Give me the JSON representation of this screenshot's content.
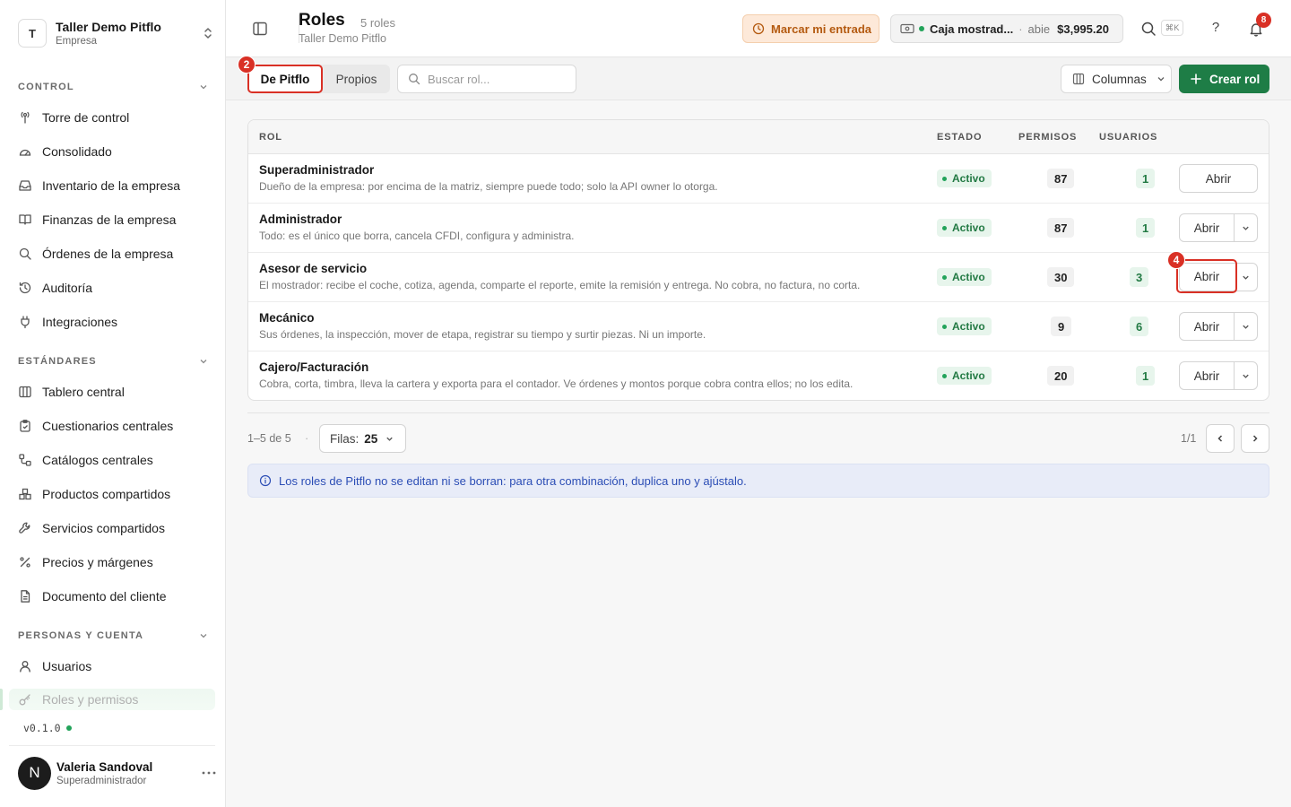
{
  "sidebar": {
    "company": {
      "initial": "T",
      "name": "Taller Demo Pitflo",
      "type": "Empresa"
    },
    "sections": [
      {
        "title": "CONTROL",
        "items": [
          {
            "label": "Torre de control",
            "icon": "antenna-icon"
          },
          {
            "label": "Consolidado",
            "icon": "gauge-icon"
          },
          {
            "label": "Inventario de la empresa",
            "icon": "inbox-icon"
          },
          {
            "label": "Finanzas de la empresa",
            "icon": "book-icon"
          },
          {
            "label": "Órdenes de la empresa",
            "icon": "search-icon"
          },
          {
            "label": "Auditoría",
            "icon": "history-icon"
          },
          {
            "label": "Integraciones",
            "icon": "plug-icon"
          }
        ]
      },
      {
        "title": "ESTÁNDARES",
        "items": [
          {
            "label": "Tablero central",
            "icon": "columns-icon"
          },
          {
            "label": "Cuestionarios centrales",
            "icon": "clipboard-icon"
          },
          {
            "label": "Catálogos centrales",
            "icon": "workflow-icon"
          },
          {
            "label": "Productos compartidos",
            "icon": "boxes-icon"
          },
          {
            "label": "Servicios compartidos",
            "icon": "wrench-icon"
          },
          {
            "label": "Precios y márgenes",
            "icon": "percent-icon"
          },
          {
            "label": "Documento del cliente",
            "icon": "file-icon"
          }
        ]
      },
      {
        "title": "PERSONAS Y CUENTA",
        "items": [
          {
            "label": "Usuarios",
            "icon": "user-icon"
          },
          {
            "label": "Roles y permisos",
            "icon": "key-icon"
          }
        ]
      }
    ],
    "version": "v0.1.0",
    "user": {
      "initial": "N",
      "name": "Valeria Sandoval",
      "role": "Superadministrador"
    }
  },
  "header": {
    "title": "Roles",
    "count": "5 roles",
    "subtitle": "Taller Demo Pitflo",
    "entry_button": "Marcar mi entrada",
    "register": {
      "name": "Caja mostrad...",
      "sep": "·",
      "state": "abie",
      "amount": "$3,995.20"
    },
    "shortcut": "⌘K",
    "help": "?",
    "notifications": "8"
  },
  "filters": {
    "tabs": [
      "De Pitflo",
      "Propios"
    ],
    "search_placeholder": "Buscar rol...",
    "columns_label": "Columnas",
    "create_label": "Crear rol"
  },
  "table": {
    "headers": {
      "rol": "ROL",
      "estado": "ESTADO",
      "permisos": "PERMISOS",
      "usuarios": "USUARIOS"
    },
    "open_label": "Abrir",
    "rows": [
      {
        "name": "Superadministrador",
        "desc": "Dueño de la empresa: por encima de la matriz, siempre puede todo; solo la API owner lo otorga.",
        "status": "Activo",
        "permisos": "87",
        "usuarios": "1"
      },
      {
        "name": "Administrador",
        "desc": "Todo: es el único que borra, cancela CFDI, configura y administra.",
        "status": "Activo",
        "permisos": "87",
        "usuarios": "1"
      },
      {
        "name": "Asesor de servicio",
        "desc": "El mostrador: recibe el coche, cotiza, agenda, comparte el reporte, emite la remisión y entrega. No cobra, no factura, no corta.",
        "status": "Activo",
        "permisos": "30",
        "usuarios": "3"
      },
      {
        "name": "Mecánico",
        "desc": "Sus órdenes, la inspección, mover de etapa, registrar su tiempo y surtir piezas. Ni un importe.",
        "status": "Activo",
        "permisos": "9",
        "usuarios": "6"
      },
      {
        "name": "Cajero/Facturación",
        "desc": "Cobra, corta, timbra, lleva la cartera y exporta para el contador. Ve órdenes y montos porque cobra contra ellos; no los edita.",
        "status": "Activo",
        "permisos": "20",
        "usuarios": "1"
      }
    ]
  },
  "pagination": {
    "range": "1–5 de 5",
    "sep": "·",
    "rows_label": "Filas:",
    "rows_value": "25",
    "page": "1/1"
  },
  "notice": "Los roles de Pitflo no se editan ni se borran: para otra combinación, duplica uno y ajústalo.",
  "markers": {
    "tab": "2",
    "row": "4"
  },
  "colors": {
    "accent": "#1e7d46",
    "marker": "#d93025",
    "status_green": "#237a44",
    "info_blue": "#2b4db5"
  }
}
